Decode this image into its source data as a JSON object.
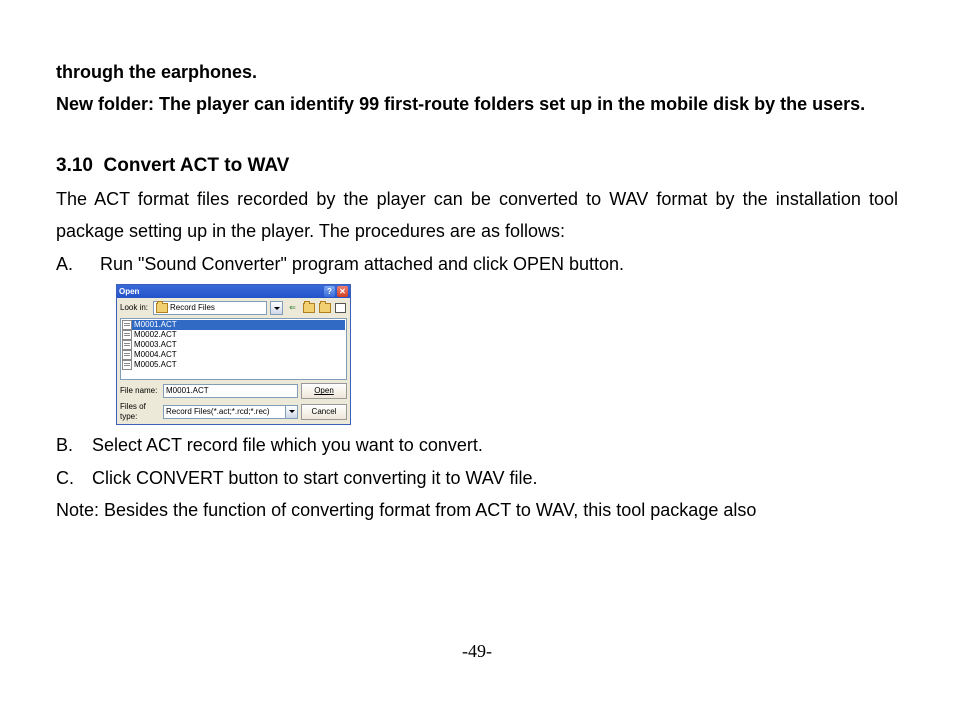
{
  "para1": "through the earphones.",
  "para2": "New folder: The player can identify 99 first-route folders set up in the mobile disk by the users.",
  "heading_num": "3.10",
  "heading_text": "Convert ACT to WAV",
  "intro": "The ACT format files recorded by the player can be converted to WAV format by the installation tool package setting up in the player. The procedures are as follows:",
  "stepA_letter": "A.",
  "stepA_text": "Run \"Sound Converter\" program attached and click OPEN button.",
  "stepB_letter": "B.",
  "stepB_text": "Select ACT record file which you want to convert.",
  "stepC_letter": "C.",
  "stepC_text": "Click CONVERT button to start converting it to WAV file.",
  "note": "Note: Besides the function of converting format from ACT to WAV, this tool package also",
  "pageno": "-49-",
  "dialog": {
    "title": "Open",
    "lookin_label": "Look in:",
    "folder_name": "Record Files",
    "tool_back": "⇐",
    "tool_up_icon": "folder-up-icon",
    "tool_new_icon": "folder-new-icon",
    "tool_view_icon": "view-icon",
    "files": [
      "M0001.ACT",
      "M0002.ACT",
      "M0003.ACT",
      "M0004.ACT",
      "M0005.ACT"
    ],
    "filename_label": "File name:",
    "filename_value": "M0001.ACT",
    "filetype_label": "Files of type:",
    "filetype_value": "Record Files(*.act;*.rcd;*.rec)",
    "open_btn": "Open",
    "cancel_btn": "Cancel",
    "help_btn": "?",
    "close_btn": "✕"
  }
}
